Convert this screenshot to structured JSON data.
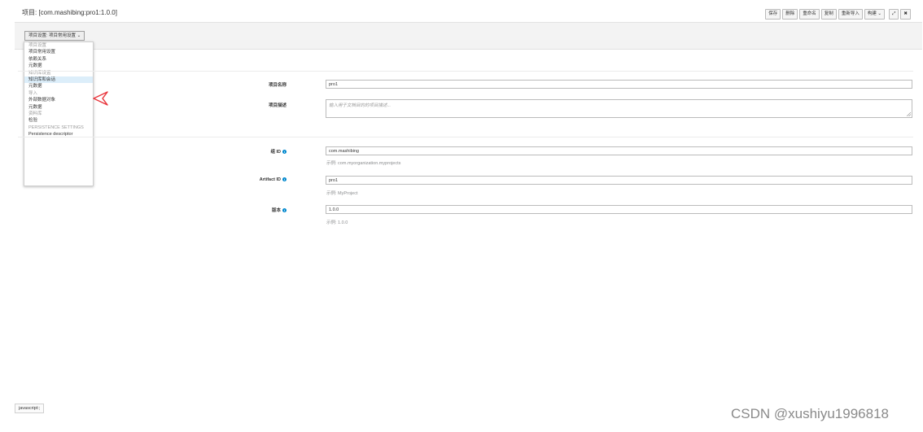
{
  "header": {
    "title": "项目: [com.mashibing:pro1:1.0.0]",
    "toolbar": {
      "save": "保存",
      "delete": "删除",
      "rename": "重命名",
      "copy": "复制",
      "reimport": "重新导入",
      "build": "构建",
      "build_caret": "⌄",
      "expand_icon": "⤢",
      "close_icon": "✖"
    }
  },
  "settings_dropdown": {
    "label": "项目设置: 项目常用设置",
    "caret": "⌄",
    "items": [
      {
        "label": "项目设置",
        "type": "header"
      },
      {
        "label": "项目常用设置",
        "type": "item"
      },
      {
        "label": "依赖关系",
        "type": "item"
      },
      {
        "label": "元数据",
        "type": "item"
      },
      {
        "label": "知识库设置",
        "type": "header"
      },
      {
        "label": "知识库和会话",
        "type": "item",
        "selected": true
      },
      {
        "label": "元数据",
        "type": "item"
      },
      {
        "label": "导入",
        "type": "header"
      },
      {
        "label": "外部数据对象",
        "type": "item"
      },
      {
        "label": "元数据",
        "type": "item"
      },
      {
        "label": "资料库",
        "type": "header"
      },
      {
        "label": "检验",
        "type": "item"
      },
      {
        "label": "PERSISTENCE SETTINGS",
        "type": "header"
      },
      {
        "label": "Persistence descriptor",
        "type": "item"
      }
    ]
  },
  "form": {
    "project_name": {
      "label": "项目名称",
      "value": "pro1"
    },
    "project_description": {
      "label": "项目描述",
      "placeholder": "输入用于文档目的的项目描述..."
    },
    "group_id": {
      "label": "组 ID",
      "value": "com.mashibing",
      "help": "示例: com.myorganization.myprojects"
    },
    "artifact_id": {
      "label": "Artifact ID",
      "value": "pro1",
      "help": "示例: MyProject"
    },
    "version": {
      "label": "版本",
      "value": "1.0.0",
      "help": "示例: 1.0.0"
    }
  },
  "status_bar": {
    "text": "javascript:;"
  },
  "watermark": {
    "text": "CSDN @xushiyu1996818"
  },
  "colors": {
    "accent_blue": "#0088ce",
    "arrow_red": "#e8333a",
    "selected_bg": "#dceefa"
  }
}
